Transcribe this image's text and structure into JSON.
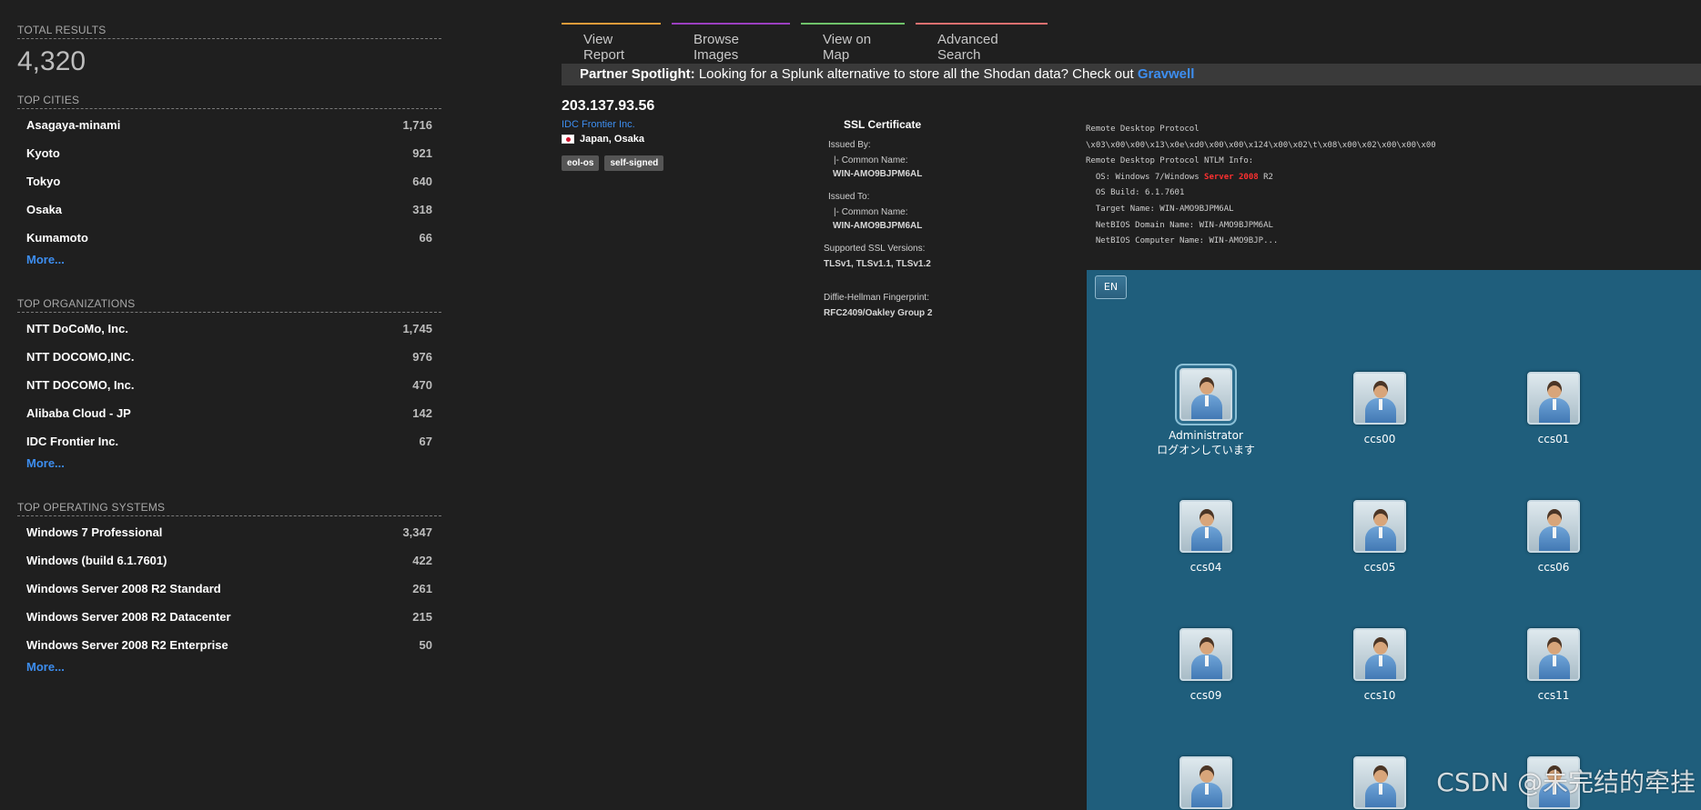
{
  "sidebar": {
    "total_results": {
      "label": "TOTAL RESULTS",
      "value": "4,320"
    },
    "top_cities": {
      "label": "TOP CITIES",
      "items": [
        {
          "name": "Asagaya-minami",
          "count": "1,716"
        },
        {
          "name": "Kyoto",
          "count": "921"
        },
        {
          "name": "Tokyo",
          "count": "640"
        },
        {
          "name": "Osaka",
          "count": "318"
        },
        {
          "name": "Kumamoto",
          "count": "66"
        }
      ],
      "more": "More..."
    },
    "top_organizations": {
      "label": "TOP ORGANIZATIONS",
      "items": [
        {
          "name": "NTT DoCoMo, Inc.",
          "count": "1,745"
        },
        {
          "name": "NTT DOCOMO,INC.",
          "count": "976"
        },
        {
          "name": "NTT DOCOMO, Inc.",
          "count": "470"
        },
        {
          "name": "Alibaba Cloud - JP",
          "count": "142"
        },
        {
          "name": "IDC Frontier Inc.",
          "count": "67"
        }
      ],
      "more": "More..."
    },
    "top_operating_systems": {
      "label": "TOP OPERATING SYSTEMS",
      "items": [
        {
          "name": "Windows 7 Professional",
          "count": "3,347"
        },
        {
          "name": "Windows (build 6.1.7601)",
          "count": "422"
        },
        {
          "name": "Windows Server 2008 R2 Standard",
          "count": "261"
        },
        {
          "name": "Windows Server 2008 R2 Datacenter",
          "count": "215"
        },
        {
          "name": "Windows Server 2008 R2 Enterprise",
          "count": "50"
        }
      ],
      "more": "More..."
    }
  },
  "nav": {
    "tabs": [
      "View Report",
      "Browse Images",
      "View on Map",
      "Advanced Search"
    ],
    "tab_colors": [
      "#e59b3a",
      "#9b3fc0",
      "#6fc36a",
      "#e07070"
    ]
  },
  "spotlight": {
    "prefix": "Partner Spotlight:",
    "text": "Looking for a Splunk alternative to store all the Shodan data? Check out",
    "link": "Gravwell"
  },
  "host": {
    "ip": "203.137.93.56",
    "org": "IDC Frontier Inc.",
    "country": "Japan",
    "city": "Osaka",
    "tags": [
      "eol-os",
      "self-signed"
    ]
  },
  "ssl": {
    "title": "SSL Certificate",
    "issued_by_label": "Issued By:",
    "issued_by_cn_label": "|- Common Name:",
    "issued_by_cn": "WIN-AMO9BJPM6AL",
    "issued_to_label": "Issued To:",
    "issued_to_cn_label": "|- Common Name:",
    "issued_to_cn": "WIN-AMO9BJPM6AL",
    "versions_label": "Supported SSL Versions:",
    "versions": "TLSv1, TLSv1.1, TLSv1.2",
    "dh_label": "Diffie-Hellman Fingerprint:",
    "dh": "RFC2409/Oakley Group 2"
  },
  "rdp": {
    "line1": "Remote Desktop Protocol",
    "line2": "\\x03\\x00\\x00\\x13\\x0e\\xd0\\x00\\x00\\x124\\x00\\x02\\t\\x08\\x00\\x02\\x00\\x00\\x00",
    "line3": "Remote Desktop Protocol NTLM Info:",
    "os_prefix": "  OS: Windows 7/Windows ",
    "os_highlight": "Server 2008",
    "os_suffix": " R2",
    "line5": "  OS Build: 6.1.7601",
    "line6": "  Target Name: WIN-AMO9BJPM6AL",
    "line7": "  NetBIOS Domain Name: WIN-AMO9BJPM6AL",
    "line8": "  NetBIOS Computer Name: WIN-AMO9BJP..."
  },
  "screenshot": {
    "lang_button": "EN",
    "users": [
      {
        "name": "Administrator",
        "status": "ログオンしています"
      },
      {
        "name": "ccs00"
      },
      {
        "name": "ccs01"
      },
      {
        "name": "ccs04"
      },
      {
        "name": "ccs05"
      },
      {
        "name": "ccs06"
      },
      {
        "name": "ccs09"
      },
      {
        "name": "ccs10"
      },
      {
        "name": "ccs11"
      }
    ]
  },
  "watermark": "CSDN @未完结的牵挂"
}
